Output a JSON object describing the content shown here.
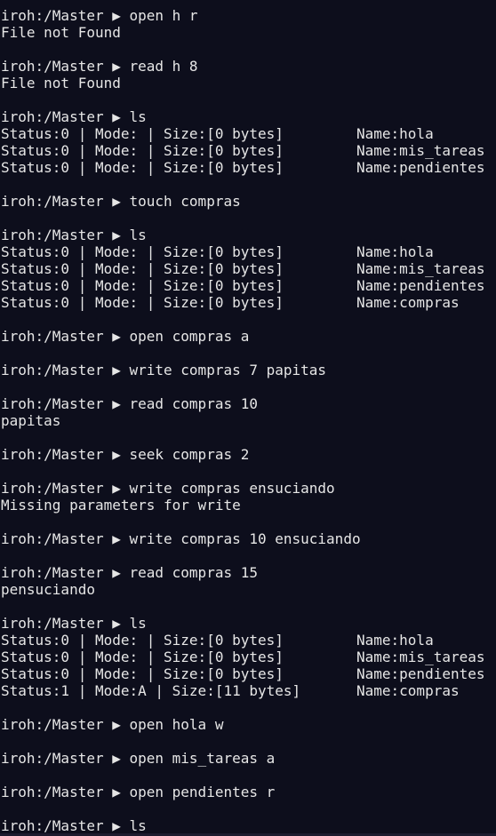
{
  "terminal": {
    "blocks": [
      {
        "prompt": "iroh:/Master ▶ open h r",
        "output": [
          "File not Found"
        ]
      },
      {
        "prompt": "iroh:/Master ▶ read h 8",
        "output": [
          "File not Found"
        ]
      },
      {
        "prompt": "iroh:/Master ▶ ls",
        "ls": [
          {
            "left": "Status:0 | Mode: | Size:[0 bytes]",
            "right": "Name:hola"
          },
          {
            "left": "Status:0 | Mode: | Size:[0 bytes]",
            "right": "Name:mis_tareas"
          },
          {
            "left": "Status:0 | Mode: | Size:[0 bytes]",
            "right": "Name:pendientes"
          }
        ]
      },
      {
        "prompt": "iroh:/Master ▶ touch compras"
      },
      {
        "prompt": "iroh:/Master ▶ ls",
        "ls": [
          {
            "left": "Status:0 | Mode: | Size:[0 bytes]",
            "right": "Name:hola"
          },
          {
            "left": "Status:0 | Mode: | Size:[0 bytes]",
            "right": "Name:mis_tareas"
          },
          {
            "left": "Status:0 | Mode: | Size:[0 bytes]",
            "right": "Name:pendientes"
          },
          {
            "left": "Status:0 | Mode: | Size:[0 bytes]",
            "right": "Name:compras"
          }
        ]
      },
      {
        "prompt": "iroh:/Master ▶ open compras a"
      },
      {
        "prompt": "iroh:/Master ▶ write compras 7 papitas"
      },
      {
        "prompt": "iroh:/Master ▶ read compras 10",
        "output": [
          "papitas"
        ]
      },
      {
        "prompt": "iroh:/Master ▶ seek compras 2"
      },
      {
        "prompt": "iroh:/Master ▶ write compras ensuciando",
        "output": [
          "Missing parameters for write"
        ]
      },
      {
        "prompt": "iroh:/Master ▶ write compras 10 ensuciando"
      },
      {
        "prompt": "iroh:/Master ▶ read compras 15",
        "output": [
          "pensuciando"
        ]
      },
      {
        "prompt": "iroh:/Master ▶ ls",
        "ls": [
          {
            "left": "Status:0 | Mode: | Size:[0 bytes]",
            "right": "Name:hola"
          },
          {
            "left": "Status:0 | Mode: | Size:[0 bytes]",
            "right": "Name:mis_tareas"
          },
          {
            "left": "Status:0 | Mode: | Size:[0 bytes]",
            "right": "Name:pendientes"
          },
          {
            "left": "Status:1 | Mode:A | Size:[11 bytes]",
            "right": "Name:compras"
          }
        ]
      },
      {
        "prompt": "iroh:/Master ▶ open hola w"
      },
      {
        "prompt": "iroh:/Master ▶ open mis_tareas a"
      },
      {
        "prompt": "iroh:/Master ▶ open pendientes r"
      },
      {
        "prompt": "iroh:/Master ▶ ls",
        "last": true
      }
    ]
  },
  "colors": {
    "background": "#0d0e1c",
    "foreground": "#e6e6e6"
  }
}
